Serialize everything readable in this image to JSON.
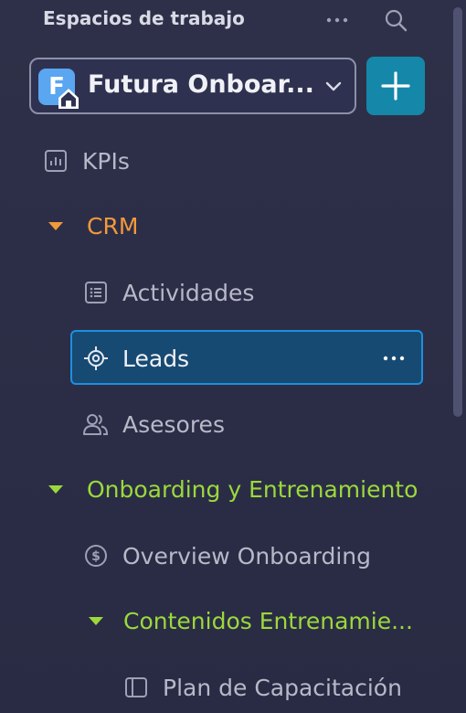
{
  "sidebar": {
    "header_title": "Espacios de trabajo",
    "workspace": {
      "avatar_letter": "F",
      "name": "Futura Onboar..."
    },
    "items": [
      {
        "label": "KPIs"
      },
      {
        "label": "CRM"
      },
      {
        "label": "Actividades"
      },
      {
        "label": "Leads"
      },
      {
        "label": "Asesores"
      },
      {
        "label": "Onboarding y Entrenamiento"
      },
      {
        "label": "Overview Onboarding"
      },
      {
        "label": "Contenidos Entrenamie..."
      },
      {
        "label": "Plan de Capacitación"
      }
    ]
  },
  "colors": {
    "accent_orange": "#f2993a",
    "accent_green": "#9bd93b",
    "selected_bg": "#174a72",
    "selected_border": "#1d8fe0",
    "add_button": "#1587a9"
  }
}
